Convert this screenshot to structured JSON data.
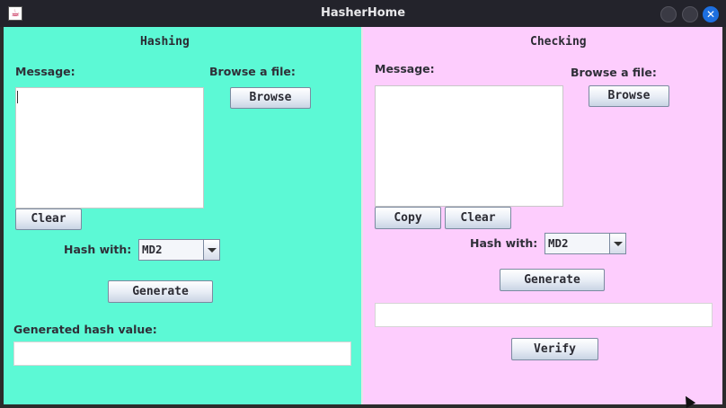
{
  "window": {
    "title": "HasherHome",
    "close_glyph": "✕"
  },
  "hashing": {
    "heading": "Hashing",
    "message_label": "Message:",
    "browse_label": "Browse a file:",
    "browse_button": "Browse",
    "clear_button": "Clear",
    "hash_with_label": "Hash with:",
    "algorithm": "MD2",
    "generate_button": "Generate",
    "generated_label": "Generated hash value:",
    "generated_value": "",
    "bg_color": "#5cf9d5"
  },
  "checking": {
    "heading": "Checking",
    "message_label": "Message:",
    "browse_label": "Browse a file:",
    "browse_button": "Browse",
    "copy_button": "Copy",
    "clear_button": "Clear",
    "hash_with_label": "Hash with:",
    "algorithm": "MD2",
    "generate_button": "Generate",
    "hash_value": "",
    "verify_button": "Verify",
    "bg_color": "#fdcdfd"
  }
}
